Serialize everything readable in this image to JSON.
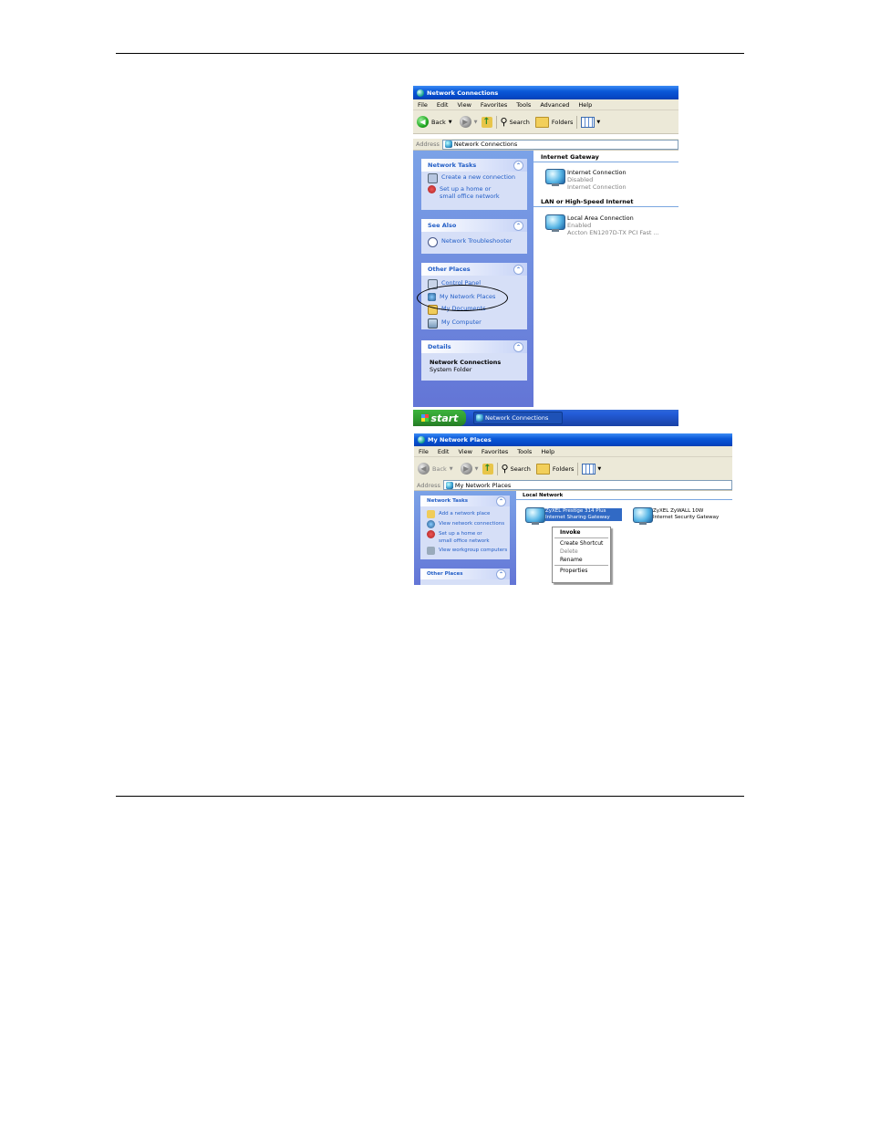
{
  "window1": {
    "title": "Network Connections",
    "menu": [
      "File",
      "Edit",
      "View",
      "Favorites",
      "Tools",
      "Advanced",
      "Help"
    ],
    "toolbar": {
      "back": "Back",
      "search": "Search",
      "folders": "Folders"
    },
    "address": {
      "label": "Address",
      "value": "Network Connections"
    },
    "panels": {
      "network_tasks": {
        "title": "Network Tasks",
        "items": [
          "Create a new connection",
          "Set up a home or small office network"
        ]
      },
      "see_also": {
        "title": "See Also",
        "items": [
          "Network Troubleshooter"
        ]
      },
      "other_places": {
        "title": "Other Places",
        "items": [
          "Control Panel",
          "My Network Places",
          "My Documents",
          "My Computer"
        ]
      },
      "details": {
        "title": "Details",
        "name": "Network Connections",
        "desc": "System Folder"
      }
    },
    "groups": [
      {
        "title": "Internet Gateway",
        "item": {
          "name": "Internet Connection",
          "status": "Disabled",
          "type": "Internet Connection"
        }
      },
      {
        "title": "LAN or High-Speed Internet",
        "item": {
          "name": "Local Area Connection",
          "status": "Enabled",
          "type": "Accton EN1207D-TX PCI Fast ..."
        }
      }
    ],
    "taskbar": {
      "start": "start",
      "task": "Network Connections"
    }
  },
  "window2": {
    "title": "My Network Places",
    "menu": [
      "File",
      "Edit",
      "View",
      "Favorites",
      "Tools",
      "Help"
    ],
    "toolbar": {
      "back": "Back",
      "search": "Search",
      "folders": "Folders"
    },
    "address": {
      "label": "Address",
      "value": "My Network Places"
    },
    "panels": {
      "network_tasks": {
        "title": "Network Tasks",
        "items": [
          "Add a network place",
          "View network connections",
          "Set up a home or small office network",
          "View workgroup computers"
        ]
      },
      "other_places": {
        "title": "Other Places"
      }
    },
    "group": "Local Network",
    "items": [
      {
        "name": "ZyXEL Prestige 314 Plus Internet Sharing Gateway"
      },
      {
        "name": "ZyXEL ZyWALL 10W Internet Security Gateway"
      }
    ],
    "context_menu": [
      "Invoke",
      "Create Shortcut",
      "Delete",
      "Rename",
      "Properties"
    ]
  }
}
